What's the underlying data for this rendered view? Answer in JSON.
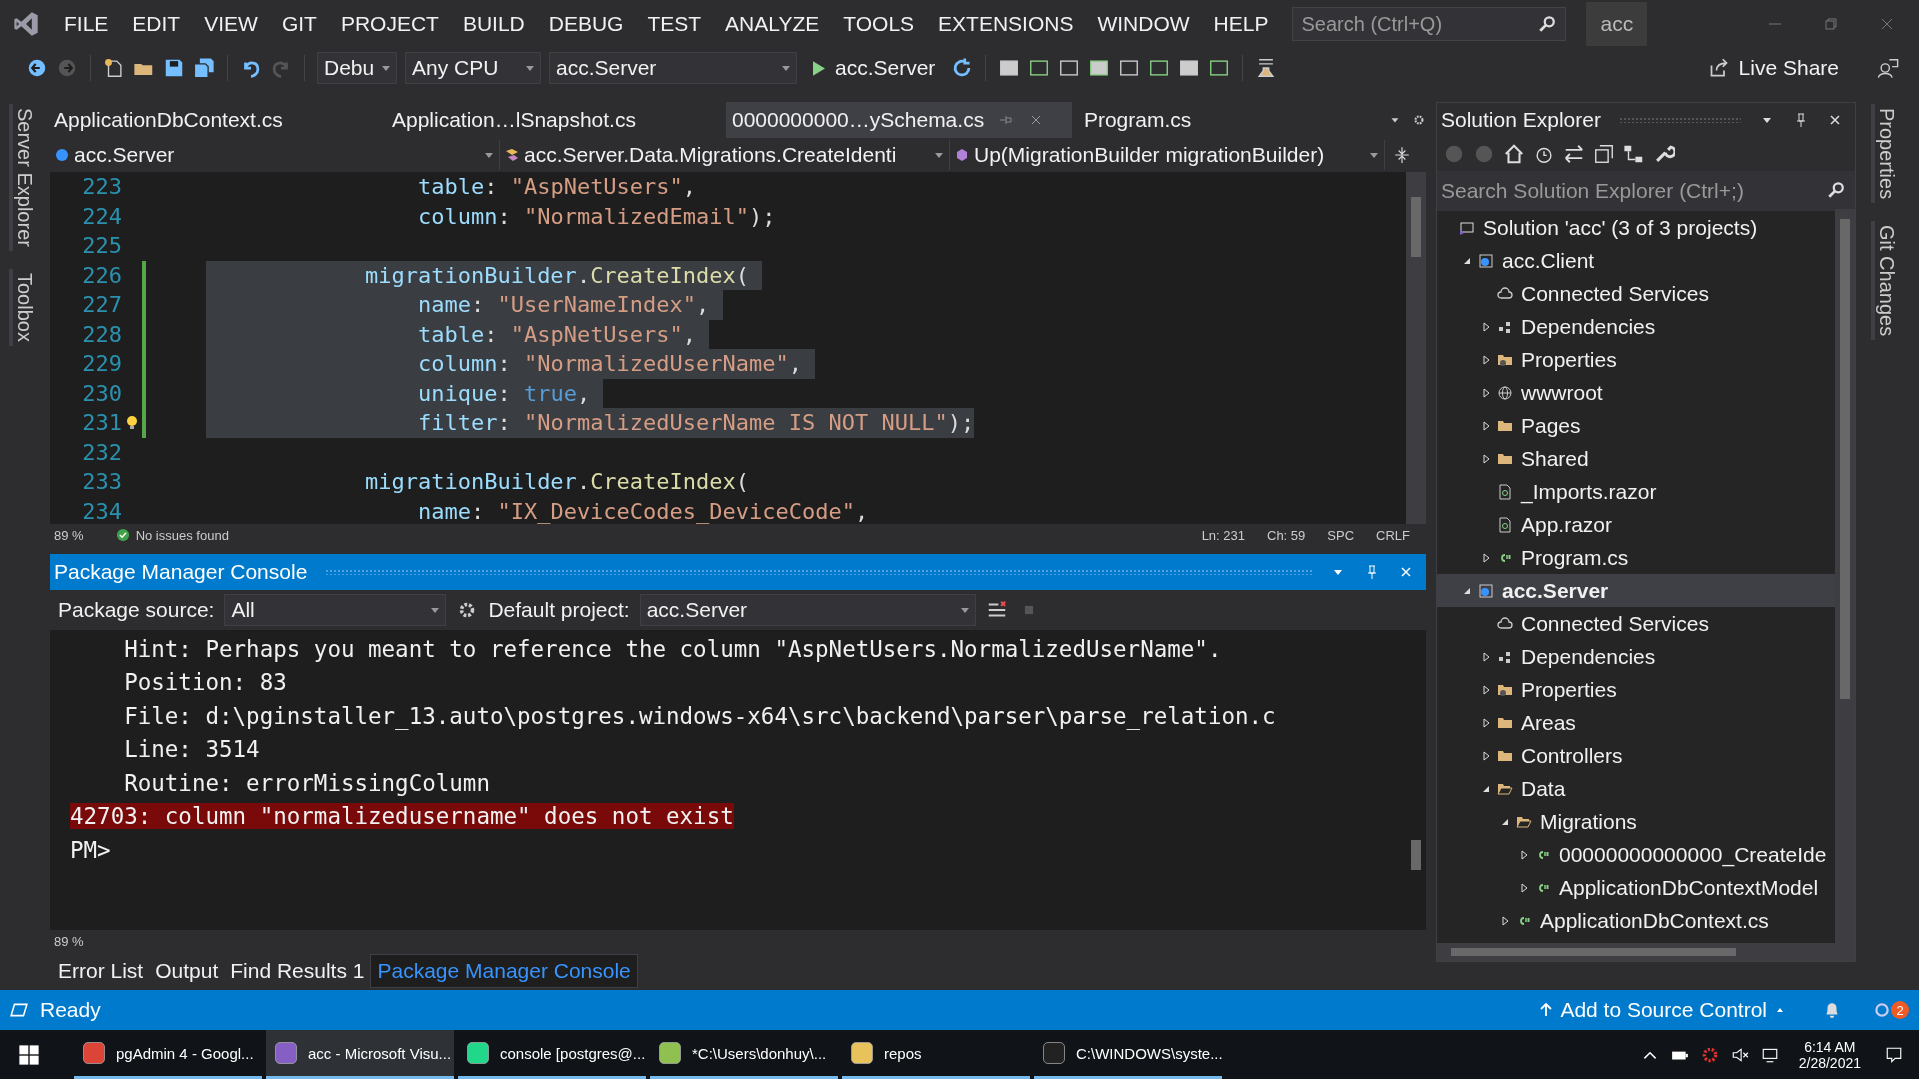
{
  "menu": [
    "FILE",
    "EDIT",
    "VIEW",
    "GIT",
    "PROJECT",
    "BUILD",
    "DEBUG",
    "TEST",
    "ANALYZE",
    "TOOLS",
    "EXTENSIONS",
    "WINDOW",
    "HELP"
  ],
  "search": {
    "placeholder": "Search (Ctrl+Q)"
  },
  "title_badge": "acc",
  "toolbar": {
    "configuration": "Debu",
    "platform": "Any CPU",
    "startup_project": "acc.Server",
    "run_label": "acc.Server",
    "live_share": "Live Share"
  },
  "side_tabs_left": [
    "Server Explorer",
    "Toolbox"
  ],
  "side_tabs_right": [
    "Properties",
    "Git Changes"
  ],
  "editor": {
    "tabs": [
      {
        "label": "ApplicationDbContext.cs",
        "selected": false
      },
      {
        "label": "Application…lSnapshot.cs",
        "selected": false
      },
      {
        "label": "0000000000…ySchema.cs",
        "selected": true
      },
      {
        "label": "Program.cs",
        "selected": false
      }
    ],
    "nav": [
      "acc.Server",
      "acc.Server.Data.Migrations.CreateIdenti",
      "Up(MigrationBuilder migrationBuilder)"
    ],
    "lines": [
      {
        "number": "223",
        "selected": false,
        "bulb": false,
        "tokens": [
          {
            "text": "                table",
            "kind": "param"
          },
          {
            "text": ": ",
            "kind": "plain"
          },
          {
            "text": "\"AspNetUsers\"",
            "kind": "string"
          },
          {
            "text": ",",
            "kind": "plain"
          }
        ]
      },
      {
        "number": "224",
        "selected": false,
        "bulb": false,
        "tokens": [
          {
            "text": "                column",
            "kind": "param"
          },
          {
            "text": ": ",
            "kind": "plain"
          },
          {
            "text": "\"NormalizedEmail\"",
            "kind": "string"
          },
          {
            "text": ");",
            "kind": "plain"
          }
        ]
      },
      {
        "number": "225",
        "selected": false,
        "bulb": false
      },
      {
        "number": "226",
        "selected": true,
        "bulb": false,
        "tokens": [
          {
            "text": "            migrationBuilder",
            "kind": "param"
          },
          {
            "text": ".",
            "kind": "plain"
          },
          {
            "text": "CreateIndex",
            "kind": "method"
          },
          {
            "text": "( ",
            "kind": "plain"
          }
        ]
      },
      {
        "number": "227",
        "selected": true,
        "bulb": false,
        "tokens": [
          {
            "text": "                name",
            "kind": "param"
          },
          {
            "text": ": ",
            "kind": "plain"
          },
          {
            "text": "\"UserNameIndex\"",
            "kind": "string"
          },
          {
            "text": ", ",
            "kind": "plain"
          }
        ]
      },
      {
        "number": "228",
        "selected": true,
        "bulb": false,
        "tokens": [
          {
            "text": "                table",
            "kind": "param"
          },
          {
            "text": ": ",
            "kind": "plain"
          },
          {
            "text": "\"AspNetUsers\"",
            "kind": "string"
          },
          {
            "text": ", ",
            "kind": "plain"
          }
        ]
      },
      {
        "number": "229",
        "selected": true,
        "bulb": false,
        "tokens": [
          {
            "text": "                column",
            "kind": "param"
          },
          {
            "text": ": ",
            "kind": "plain"
          },
          {
            "text": "\"NormalizedUserName\"",
            "kind": "string"
          },
          {
            "text": ", ",
            "kind": "plain"
          }
        ]
      },
      {
        "number": "230",
        "selected": true,
        "bulb": false,
        "tokens": [
          {
            "text": "                unique",
            "kind": "param"
          },
          {
            "text": ": ",
            "kind": "plain"
          },
          {
            "text": "true",
            "kind": "keyword"
          },
          {
            "text": ", ",
            "kind": "plain"
          }
        ]
      },
      {
        "number": "231",
        "selected": true,
        "bulb": true,
        "tokens": [
          {
            "text": "                filter",
            "kind": "param"
          },
          {
            "text": ": ",
            "kind": "plain"
          },
          {
            "text": "\"NormalizedUserName IS NOT NULL\"",
            "kind": "string"
          },
          {
            "text": ");",
            "kind": "plain"
          }
        ]
      },
      {
        "number": "232",
        "selected": false,
        "bulb": false
      },
      {
        "number": "233",
        "selected": false,
        "bulb": false,
        "tokens": [
          {
            "text": "            migrationBuilder",
            "kind": "param"
          },
          {
            "text": ".",
            "kind": "plain"
          },
          {
            "text": "CreateIndex",
            "kind": "method"
          },
          {
            "text": "(",
            "kind": "plain"
          }
        ]
      },
      {
        "number": "234",
        "selected": false,
        "bulb": false,
        "tokens": [
          {
            "text": "                name",
            "kind": "param"
          },
          {
            "text": ": ",
            "kind": "plain"
          },
          {
            "text": "\"IX_DeviceCodes_DeviceCode\"",
            "kind": "string"
          },
          {
            "text": ",",
            "kind": "plain"
          }
        ]
      }
    ],
    "status": {
      "zoom": "89 %",
      "issues": "No issues found",
      "line": "Ln: 231",
      "column": "Ch: 59",
      "spacing": "SPC",
      "line_endings": "CRLF"
    }
  },
  "console": {
    "title": "Package Manager Console",
    "source_label": "Package source:",
    "source": "All",
    "project_label": "Default project:",
    "project": "acc.Server",
    "lines": [
      {
        "text": "    Hint: Perhaps you meant to reference the column \"AspNetUsers.NormalizedUserName\".",
        "kind": "plain"
      },
      {
        "text": "    Position: 83",
        "kind": "plain"
      },
      {
        "text": "    File: d:\\pginstaller_13.auto\\postgres.windows-x64\\src\\backend\\parser\\parse_relation.c",
        "kind": "plain"
      },
      {
        "text": "    Line: 3514",
        "kind": "plain"
      },
      {
        "text": "    Routine: errorMissingColumn",
        "kind": "plain"
      },
      {
        "text": "42703: column \"normalizedusername\" does not exist",
        "kind": "error"
      },
      {
        "text": "PM>",
        "kind": "plain"
      }
    ],
    "zoom": "89 %"
  },
  "bottom_tabs": [
    {
      "label": "Error List",
      "selected": false
    },
    {
      "label": "Output",
      "selected": false
    },
    {
      "label": "Find Results 1",
      "selected": false
    },
    {
      "label": "Package Manager Console",
      "selected": true
    }
  ],
  "solution_explorer": {
    "title": "Solution Explorer",
    "search_placeholder": "Search Solution Explorer (Ctrl+;)",
    "tree": [
      {
        "label": "Solution 'acc' (3 of 3 projects)",
        "kind": "solution",
        "selected": false,
        "children": [
          {
            "label": "acc.Client",
            "kind": "project",
            "expanded": true,
            "selected": false,
            "children": [
              {
                "label": "Connected Services",
                "kind": "cloud",
                "selected": false
              },
              {
                "label": "Dependencies",
                "kind": "deps",
                "expanded": false,
                "selected": false
              },
              {
                "label": "Properties",
                "kind": "props",
                "expanded": false,
                "selected": false
              },
              {
                "label": "wwwroot",
                "kind": "globe",
                "expanded": false,
                "selected": false
              },
              {
                "label": "Pages",
                "kind": "folder",
                "expanded": false,
                "selected": false
              },
              {
                "label": "Shared",
                "kind": "folder",
                "expanded": false,
                "selected": false
              },
              {
                "label": "_Imports.razor",
                "kind": "razor",
                "selected": false
              },
              {
                "label": "App.razor",
                "kind": "razor",
                "selected": false
              },
              {
                "label": "Program.cs",
                "kind": "csharp",
                "expanded": false,
                "selected": false
              }
            ]
          },
          {
            "label": "acc.Server",
            "kind": "project",
            "expanded": true,
            "selected": true,
            "children": [
              {
                "label": "Connected Services",
                "kind": "cloud",
                "selected": false
              },
              {
                "label": "Dependencies",
                "kind": "deps",
                "expanded": false,
                "selected": false
              },
              {
                "label": "Properties",
                "kind": "props",
                "expanded": false,
                "selected": false
              },
              {
                "label": "Areas",
                "kind": "folder",
                "expanded": false,
                "selected": false
              },
              {
                "label": "Controllers",
                "kind": "folder",
                "expanded": false,
                "selected": false
              },
              {
                "label": "Data",
                "kind": "folder",
                "expanded": true,
                "selected": false,
                "children": [
                  {
                    "label": "Migrations",
                    "kind": "folder",
                    "expanded": true,
                    "selected": false,
                    "children": [
                      {
                        "label": "00000000000000_CreateIde",
                        "kind": "csharp",
                        "expanded": false,
                        "selected": false
                      },
                      {
                        "label": "ApplicationDbContextModel",
                        "kind": "csharp",
                        "expanded": false,
                        "selected": false
                      }
                    ]
                  },
                  {
                    "label": "ApplicationDbContext.cs",
                    "kind": "csharp",
                    "expanded": false,
                    "selected": false
                  }
                ]
              }
            ]
          }
        ]
      }
    ]
  },
  "status_bar": {
    "text": "Ready",
    "source_control": "Add to Source Control",
    "notifications": "2"
  },
  "taskbar": {
    "apps": [
      {
        "label": "pgAdmin 4 - Googl...",
        "kind": "browser",
        "active": false
      },
      {
        "label": "acc - Microsoft Visu...",
        "kind": "ide",
        "active": true
      },
      {
        "label": "console [postgres@...",
        "kind": "database",
        "active": false
      },
      {
        "label": "*C:\\Users\\donhuy\\...",
        "kind": "editor",
        "active": false
      },
      {
        "label": "repos",
        "kind": "folder",
        "active": false
      },
      {
        "label": "C:\\WINDOWS\\syste...",
        "kind": "terminal",
        "active": false
      }
    ],
    "time": "6:14 AM",
    "date": "2/28/2021"
  }
}
